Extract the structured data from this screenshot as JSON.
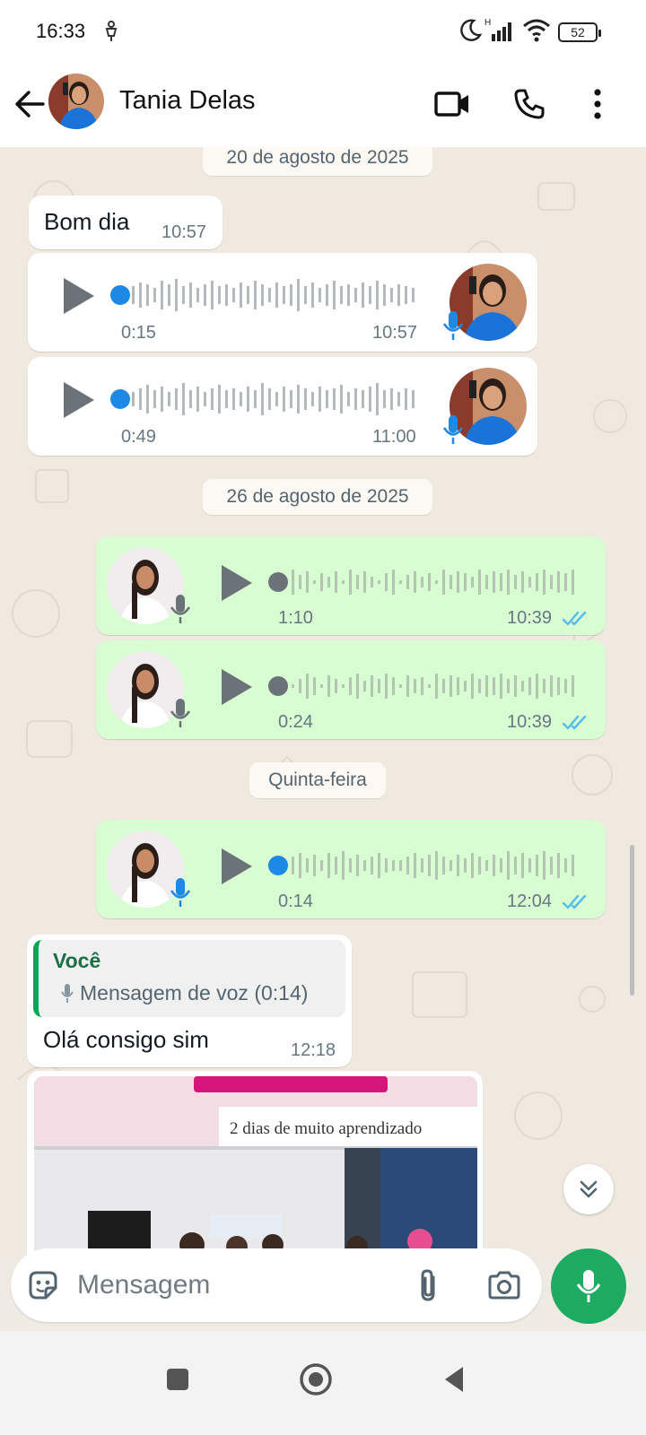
{
  "status_bar": {
    "time": "16:33",
    "battery": "52",
    "icons": [
      "usb-debug-icon",
      "moon-icon",
      "signal-icon",
      "wifi-icon",
      "battery-icon"
    ]
  },
  "header": {
    "contact_name": "Tania Delas",
    "icons": [
      "back-arrow-icon",
      "video-call-icon",
      "phone-icon",
      "more-vert-icon"
    ]
  },
  "date_separators": {
    "d1": "20 de agosto de 2025",
    "d2": "26 de agosto de 2025",
    "d3": "Quinta-feira"
  },
  "messages": [
    {
      "direction": "in",
      "type": "text",
      "text": "Bom dia",
      "time": "10:57"
    },
    {
      "direction": "in",
      "type": "voice",
      "duration": "0:15",
      "time": "10:57"
    },
    {
      "direction": "in",
      "type": "voice",
      "duration": "0:49",
      "time": "11:00"
    },
    {
      "direction": "out",
      "type": "voice",
      "duration": "1:10",
      "time": "10:39",
      "status": "read"
    },
    {
      "direction": "out",
      "type": "voice",
      "duration": "0:24",
      "time": "10:39",
      "status": "read"
    },
    {
      "direction": "out",
      "type": "voice",
      "duration": "0:14",
      "time": "12:04",
      "status": "read"
    },
    {
      "direction": "in",
      "type": "reply",
      "quote_author": "Você",
      "quote_text": "Mensagem de voz (0:14)",
      "text": "Olá consigo sim",
      "time": "12:18"
    },
    {
      "direction": "in",
      "type": "image",
      "banner_text": "2 dias de muito aprendizado"
    }
  ],
  "composer": {
    "placeholder": "Mensagem",
    "icons": [
      "sticker-icon",
      "attach-icon",
      "camera-icon",
      "mic-icon"
    ]
  },
  "colors": {
    "outgoing_bubble": "#d9fdd3",
    "incoming_bubble": "#ffffff",
    "accent_green": "#1daa61",
    "unplayed_dot": "#1e88e5",
    "read_ticks": "#53bdeb"
  }
}
